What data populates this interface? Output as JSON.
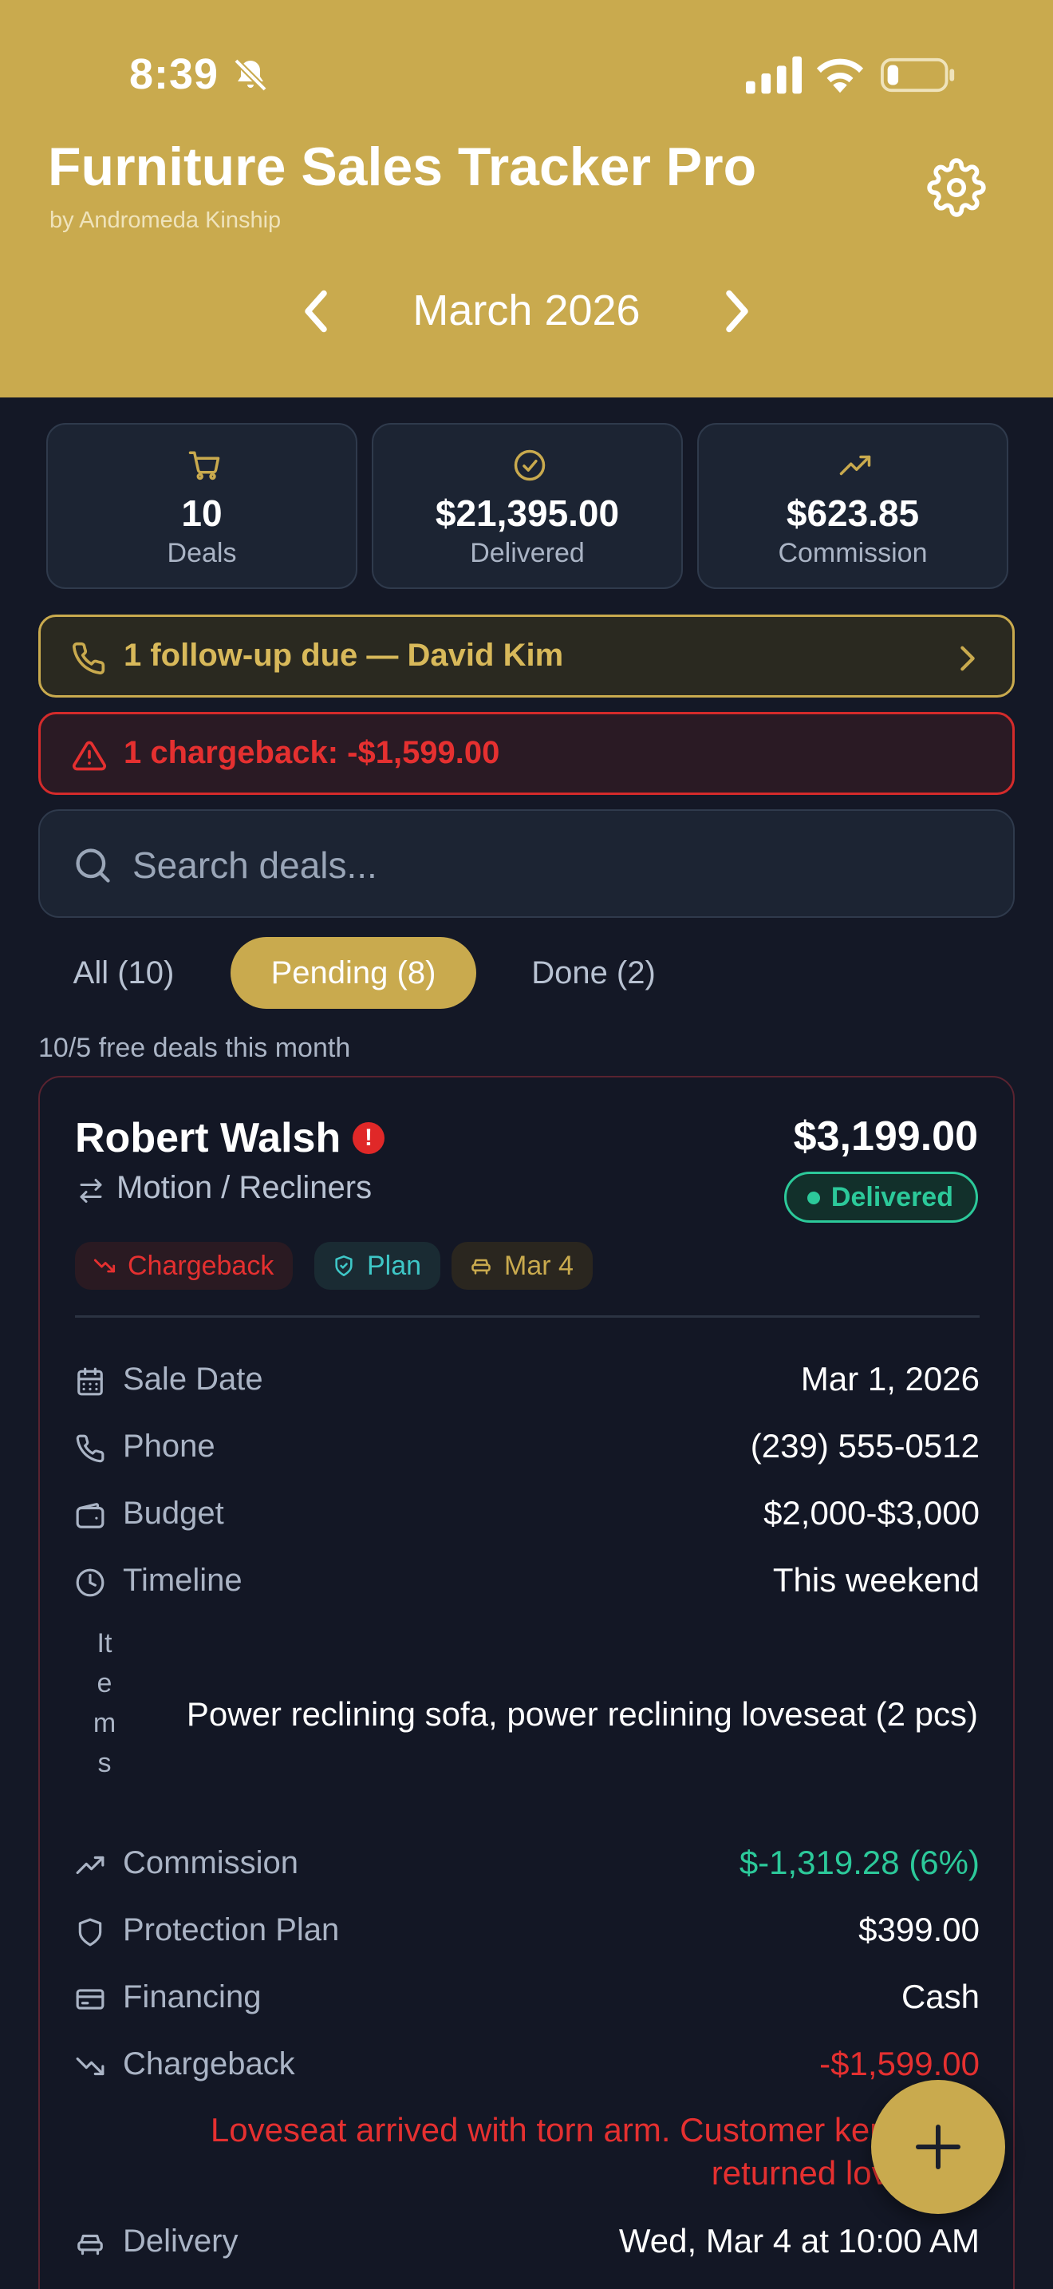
{
  "status_bar": {
    "time": "8:39"
  },
  "header": {
    "title": "Furniture Sales Tracker Pro",
    "subtitle": "by Andromeda Kinship",
    "month": "March 2026"
  },
  "stats": [
    {
      "value": "10",
      "label": "Deals",
      "icon": "cart-icon"
    },
    {
      "value": "$21,395.00",
      "label": "Delivered",
      "icon": "check-circle-icon"
    },
    {
      "value": "$623.85",
      "label": "Commission",
      "icon": "trending-up-icon"
    }
  ],
  "alerts": {
    "followup": "1 follow-up due — David Kim",
    "chargeback": "1 chargeback: -$1,599.00"
  },
  "search": {
    "placeholder": "Search deals..."
  },
  "filters": [
    {
      "label": "All (10)",
      "active": false
    },
    {
      "label": "Pending (8)",
      "active": true
    },
    {
      "label": "Done (2)",
      "active": false
    }
  ],
  "free_note": "10/5 free deals this month",
  "deal": {
    "customer": "Robert Walsh",
    "warning_mark": "!",
    "category": "Motion / Recliners",
    "amount": "$3,199.00",
    "status": "Delivered",
    "tags": {
      "chargeback": "Chargeback",
      "plan": "Plan",
      "delivery": "Mar 4"
    },
    "rows": {
      "sale_date": {
        "label": "Sale Date",
        "value": "Mar 1, 2026"
      },
      "phone": {
        "label": "Phone",
        "value": "(239) 555-0512"
      },
      "budget": {
        "label": "Budget",
        "value": "$2,000-$3,000"
      },
      "timeline": {
        "label": "Timeline",
        "value": "This weekend"
      },
      "commission": {
        "label": "Commission",
        "value": "$-1,319.28 (6%)"
      },
      "protection_plan": {
        "label": "Protection Plan",
        "value": "$399.00"
      },
      "financing": {
        "label": "Financing",
        "value": "Cash"
      },
      "chargeback": {
        "label": "Chargeback",
        "value": "-$1,599.00"
      },
      "delivery": {
        "label": "Delivery",
        "value": "Wed, Mar 4 at 10:00 AM"
      }
    },
    "items_label": "Items",
    "items_value": "Power reclining sofa, power reclining loveseat (2 pcs)",
    "chargeback_note_line1": "Loveseat arrived with torn arm. Customer kept sofa,",
    "chargeback_note_line2": "returned loveseat."
  },
  "colors": {
    "accent": "#c9aa4e",
    "background": "#141826",
    "card": "#1c2433",
    "success": "#2cc99a",
    "danger": "#e53030",
    "teal": "#3ec7c7"
  }
}
